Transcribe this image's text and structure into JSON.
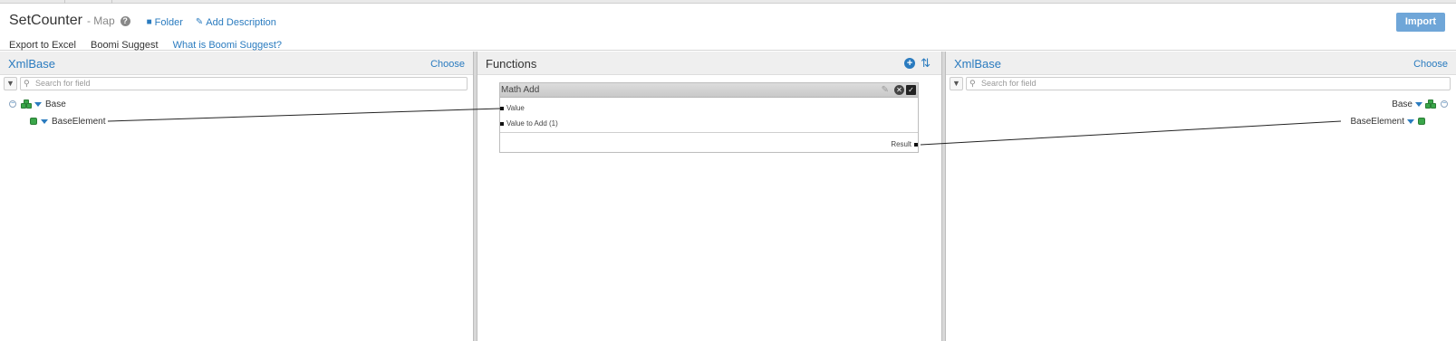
{
  "header": {
    "title": "SetCounter",
    "subtitle": "- Map",
    "help_icon": "question-circle",
    "folder_label": "Folder",
    "add_description_label": "Add Description",
    "import_label": "Import",
    "export_excel_label": "Export to Excel",
    "boomi_suggest_label": "Boomi Suggest",
    "what_is_suggest_label": "What is Boomi Suggest?"
  },
  "source": {
    "title": "XmlBase",
    "choose_label": "Choose",
    "search_placeholder": "Search for field",
    "root": "Base",
    "child": "BaseElement"
  },
  "functions": {
    "title": "Functions",
    "function_name": "Math Add",
    "input_1": "Value",
    "input_2": "Value to Add (1)",
    "output": "Result"
  },
  "destination": {
    "title": "XmlBase",
    "choose_label": "Choose",
    "search_placeholder": "Search for field",
    "root": "Base",
    "child": "BaseElement"
  },
  "colors": {
    "accent": "#2a7bbf",
    "import_button": "#6fa6d8",
    "element_icon": "#3aa64a"
  }
}
